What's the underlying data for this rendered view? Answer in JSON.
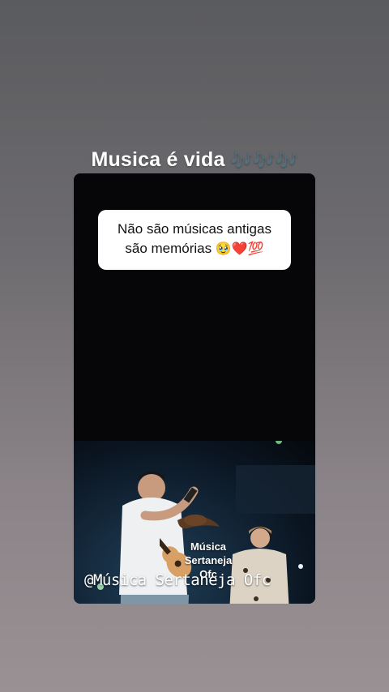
{
  "story": {
    "title": "Musica é vida",
    "title_emoji": "🎶🎶🎶"
  },
  "caption": {
    "line1": "Não são músicas antigas",
    "line2": "são memórias",
    "line2_emoji": "🥹❤️💯"
  },
  "watermark": {
    "logo_text_line1": "Música",
    "logo_text_line2": "Sertaneja",
    "logo_text_line3": "Ofc",
    "handle": "@Música Sertaneja Ofc"
  },
  "colors": {
    "background_top": "#5a5b5e",
    "background_bottom": "#9a9194",
    "card": "#060608",
    "caption_bg": "#ffffff",
    "emoji_accent": "#c08cf0"
  },
  "icons": [
    "guitar-icon",
    "cowboy-hat-icon"
  ]
}
